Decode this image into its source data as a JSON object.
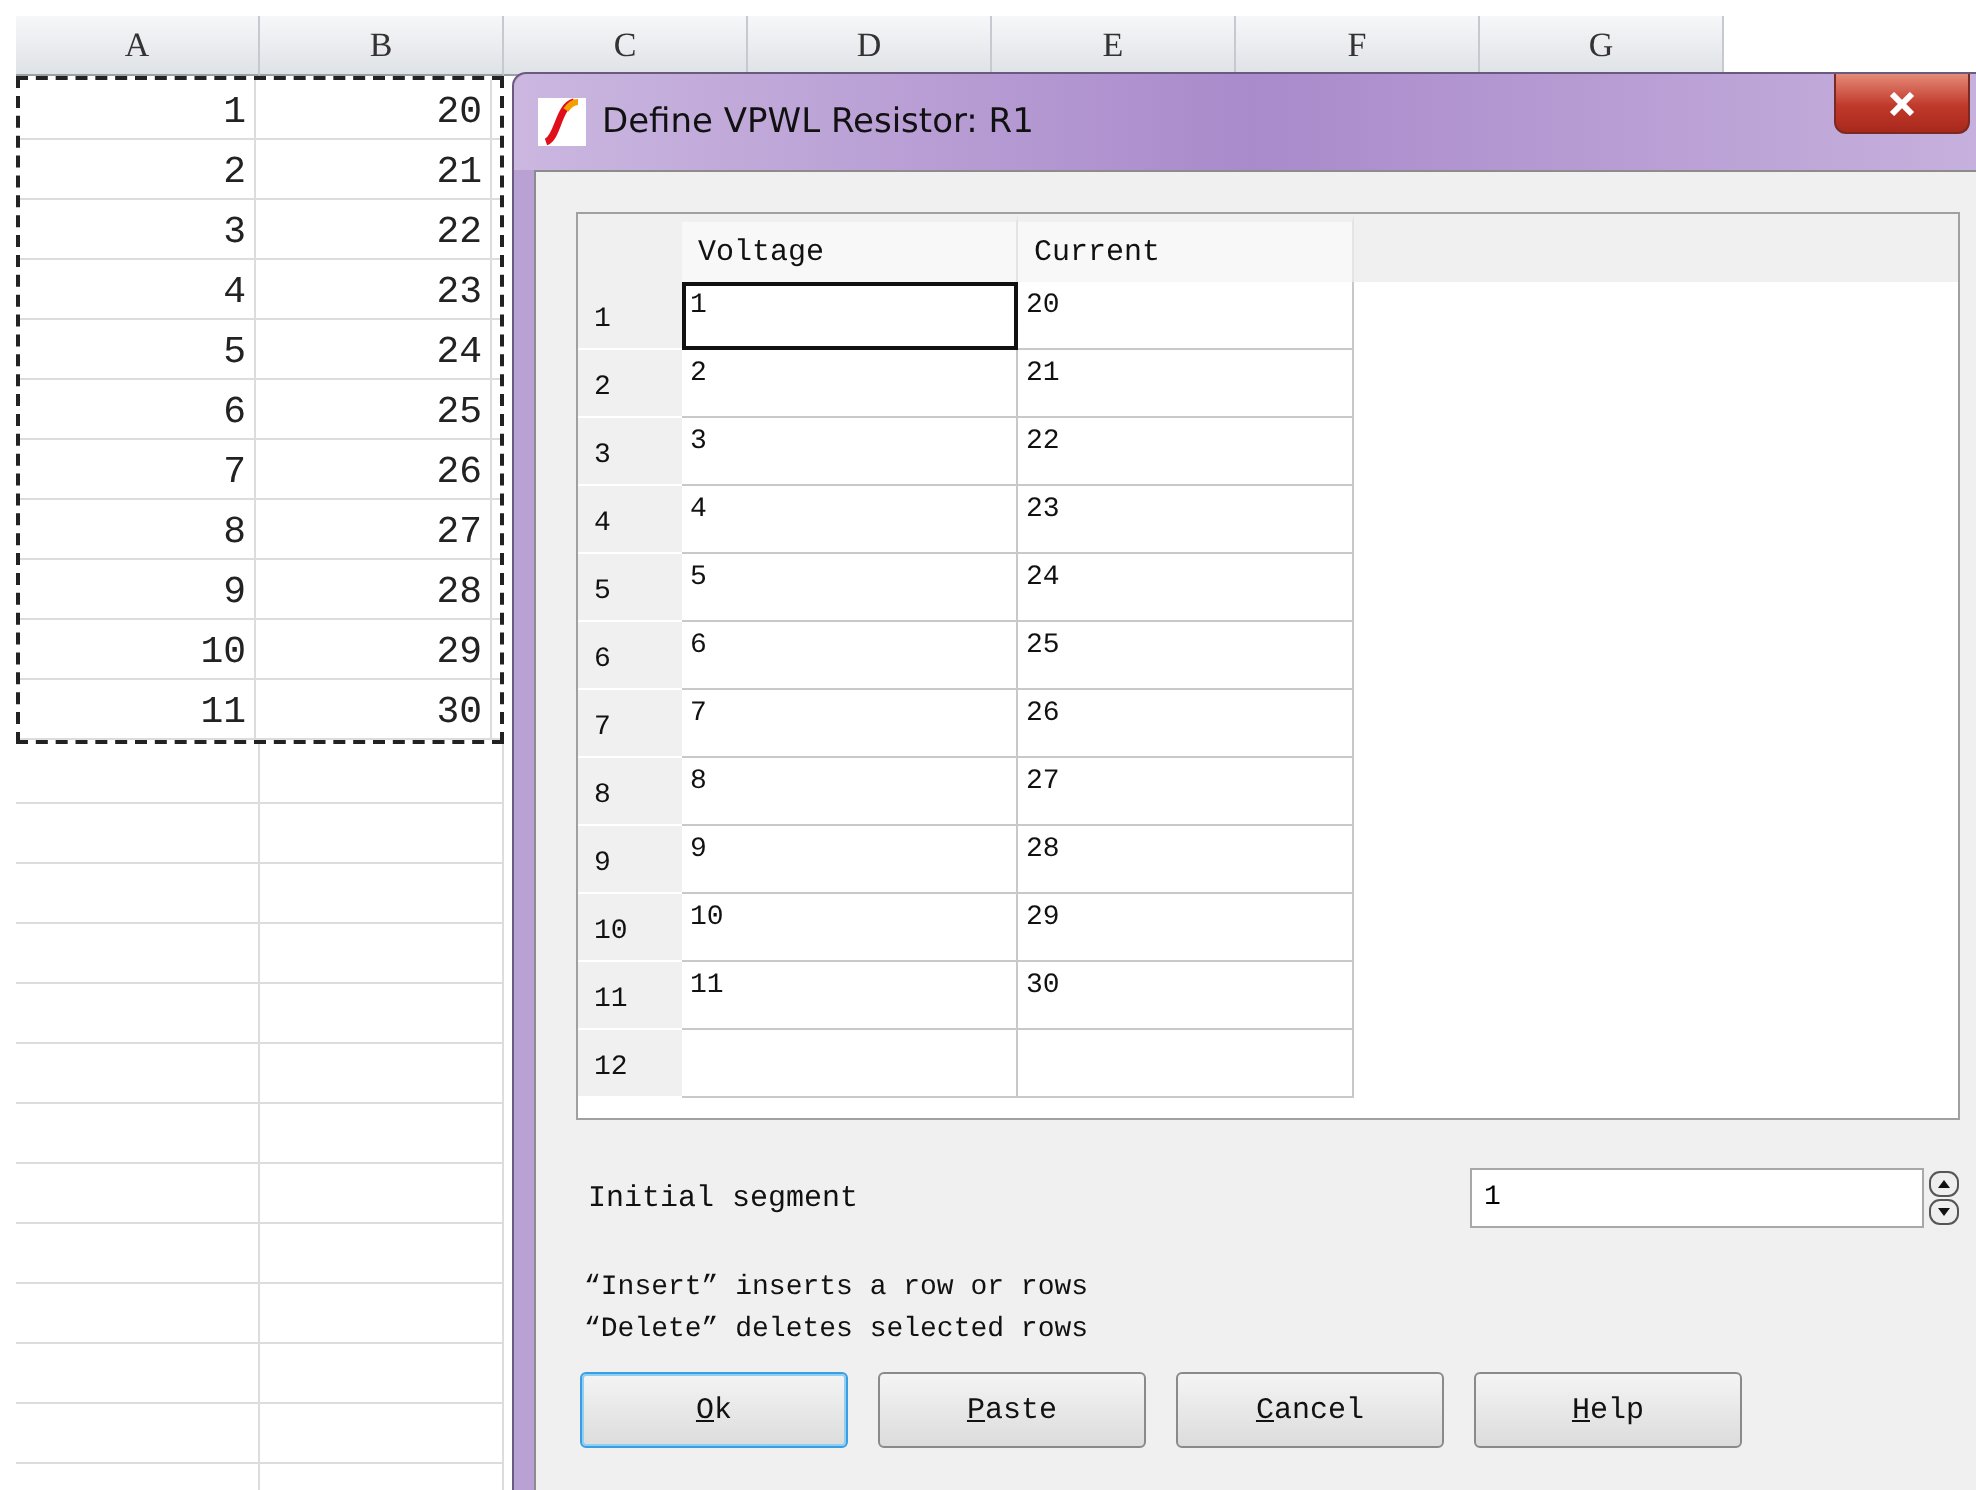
{
  "sheet": {
    "columns": [
      "A",
      "B",
      "C",
      "D",
      "E",
      "F",
      "G"
    ],
    "copy_marquee": true,
    "rows": [
      [
        "1",
        "20"
      ],
      [
        "2",
        "21"
      ],
      [
        "3",
        "22"
      ],
      [
        "4",
        "23"
      ],
      [
        "5",
        "24"
      ],
      [
        "6",
        "25"
      ],
      [
        "7",
        "26"
      ],
      [
        "8",
        "27"
      ],
      [
        "9",
        "28"
      ],
      [
        "10",
        "29"
      ],
      [
        "11",
        "30"
      ]
    ]
  },
  "dialog": {
    "title": "Define VPWL Resistor: R1",
    "grid": {
      "columns": [
        "Voltage",
        "Current"
      ],
      "rows": [
        {
          "header": "1",
          "cells": [
            {
              "text": "1",
              "selected": true
            },
            {
              "text": "20",
              "selected": false
            }
          ]
        },
        {
          "header": "2",
          "cells": [
            {
              "text": "2",
              "selected": false
            },
            {
              "text": "21",
              "selected": false
            }
          ]
        },
        {
          "header": "3",
          "cells": [
            {
              "text": "3",
              "selected": false
            },
            {
              "text": "22",
              "selected": false
            }
          ]
        },
        {
          "header": "4",
          "cells": [
            {
              "text": "4",
              "selected": false
            },
            {
              "text": "23",
              "selected": false
            }
          ]
        },
        {
          "header": "5",
          "cells": [
            {
              "text": "5",
              "selected": false
            },
            {
              "text": "24",
              "selected": false
            }
          ]
        },
        {
          "header": "6",
          "cells": [
            {
              "text": "6",
              "selected": false
            },
            {
              "text": "25",
              "selected": false
            }
          ]
        },
        {
          "header": "7",
          "cells": [
            {
              "text": "7",
              "selected": false
            },
            {
              "text": "26",
              "selected": false
            }
          ]
        },
        {
          "header": "8",
          "cells": [
            {
              "text": "8",
              "selected": false
            },
            {
              "text": "27",
              "selected": false
            }
          ]
        },
        {
          "header": "9",
          "cells": [
            {
              "text": "9",
              "selected": false
            },
            {
              "text": "28",
              "selected": false
            }
          ]
        },
        {
          "header": "10",
          "cells": [
            {
              "text": "10",
              "selected": false
            },
            {
              "text": "29",
              "selected": false
            }
          ]
        },
        {
          "header": "11",
          "cells": [
            {
              "text": "11",
              "selected": false
            },
            {
              "text": "30",
              "selected": false
            }
          ]
        },
        {
          "header": "12",
          "cells": [
            {
              "text": "",
              "selected": false
            },
            {
              "text": "",
              "selected": false
            }
          ]
        }
      ]
    },
    "initial_segment": {
      "label": "Initial segment",
      "value": "1"
    },
    "notes": [
      "“Insert” inserts a row or rows",
      "“Delete” deletes selected rows"
    ],
    "buttons": [
      {
        "label": "Ok",
        "first_letter_underlined": true,
        "default": true
      },
      {
        "label": "Paste",
        "first_letter_underlined": true,
        "default": false
      },
      {
        "label": "Cancel",
        "first_letter_underlined": true,
        "default": false
      },
      {
        "label": "Help",
        "first_letter_underlined": true,
        "default": false
      }
    ]
  }
}
